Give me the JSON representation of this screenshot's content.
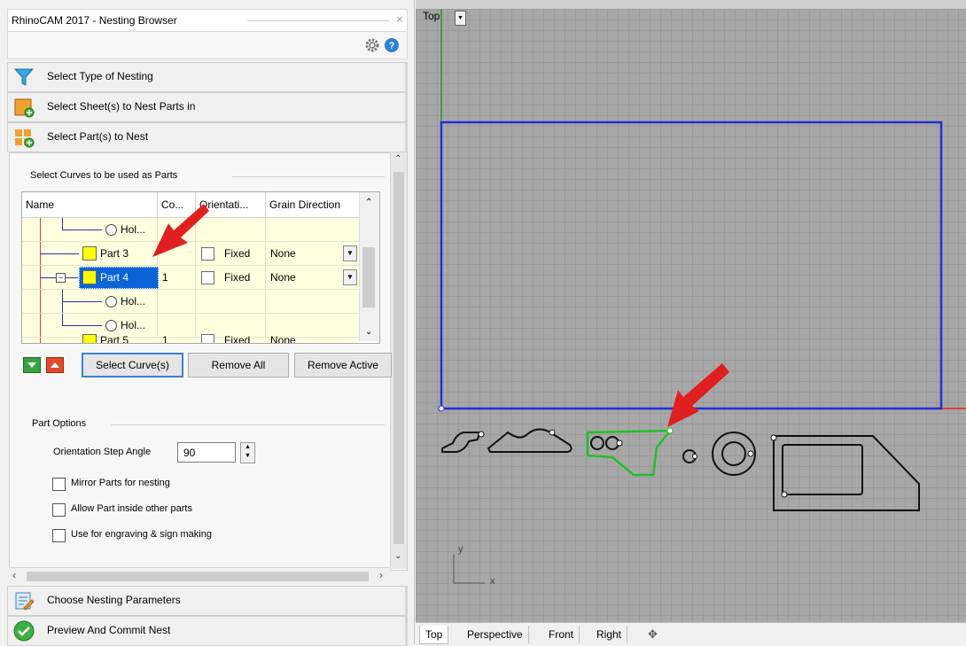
{
  "panel": {
    "title": "RhinoCAM 2017 - Nesting Browser",
    "close": "×",
    "steps": [
      {
        "label": "Select Type of Nesting",
        "icon": "funnel-icon"
      },
      {
        "label": "Select Sheet(s) to Nest Parts in",
        "icon": "sheet-add-icon"
      },
      {
        "label": "Select Part(s) to Nest",
        "icon": "parts-add-icon"
      }
    ],
    "curves_group": "Select Curves to be used as Parts",
    "columns": [
      "Name",
      "Co...",
      "Orientati...",
      "Grain Direction"
    ],
    "rows": [
      {
        "name": "Hol...",
        "type": "hole",
        "count": "",
        "orientation": "",
        "grain": ""
      },
      {
        "name": "Part 3",
        "type": "part",
        "count": "",
        "orientation": "Fixed",
        "grain": "None"
      },
      {
        "name": "Part 4",
        "type": "part",
        "count": "1",
        "orientation": "Fixed",
        "grain": "None",
        "selected": true
      },
      {
        "name": "Hol...",
        "type": "hole",
        "count": "",
        "orientation": "",
        "grain": ""
      },
      {
        "name": "Hol...",
        "type": "hole",
        "count": "",
        "orientation": "",
        "grain": ""
      },
      {
        "name": "Part 5",
        "type": "part",
        "count": "1",
        "orientation": "Fixed",
        "grain": "None"
      }
    ],
    "buttons": {
      "select_curves": "Select Curve(s)",
      "remove_all": "Remove All",
      "remove_active": "Remove Active"
    },
    "part_options": {
      "group": "Part Options",
      "step_angle_label": "Orientation Step Angle",
      "step_angle_value": "90",
      "mirror": "Mirror Parts for nesting",
      "allow_inside": "Allow Part inside other parts",
      "engraving": "Use for engraving & sign making"
    },
    "bottom_steps": [
      {
        "label": "Choose Nesting Parameters",
        "icon": "parameters-icon"
      },
      {
        "label": "Preview And Commit Nest",
        "icon": "commit-check-icon"
      }
    ]
  },
  "viewport": {
    "name": "Top",
    "axis_y": "y",
    "axis_x": "x",
    "tabs": [
      "Top",
      "Perspective",
      "Front",
      "Right"
    ],
    "colors": {
      "sheet": "#1f2fe0",
      "selected_part": "#22c02a",
      "arrow": "#e02020"
    }
  }
}
